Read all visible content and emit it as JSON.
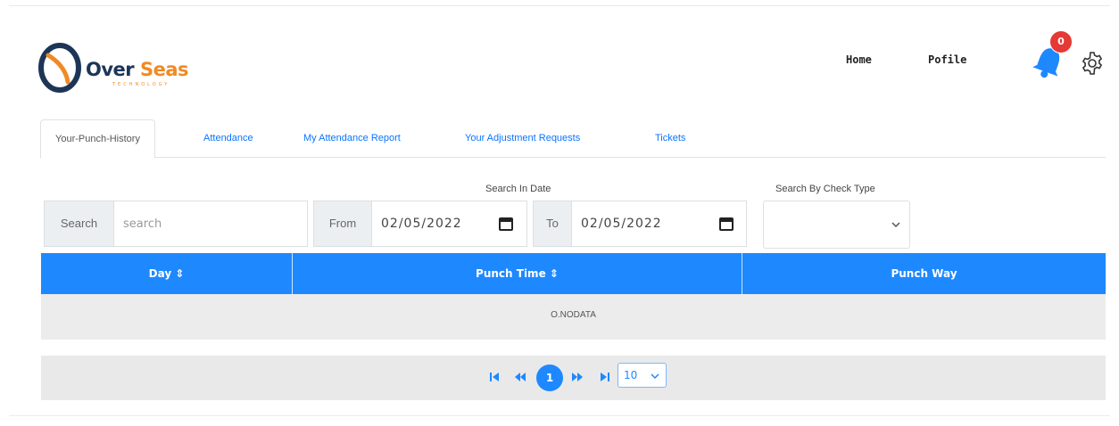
{
  "brand": {
    "name_part1": "Over",
    "name_part2": "Seas",
    "subtitle": "TECHNOLOGY"
  },
  "nav": {
    "home": "Home",
    "profile": "Pofile"
  },
  "notifications": {
    "count": "0"
  },
  "tabs": [
    {
      "label": "Your-Punch-History",
      "active": true
    },
    {
      "label": "Attendance"
    },
    {
      "label": "My Attendance Report"
    },
    {
      "label": "Your Adjustment Requests"
    },
    {
      "label": "Tickets"
    }
  ],
  "filters": {
    "search_label": "Search",
    "search_placeholder": "search",
    "date_title": "Search In Date",
    "from_label": "From",
    "from_value": "02/05/2022",
    "to_label": "To",
    "to_value": "02/05/2022",
    "check_type_title": "Search By Check Type",
    "check_type_value": ""
  },
  "table": {
    "columns": [
      "Day ⇕",
      "Punch Time ⇕",
      "Punch Way"
    ],
    "empty_message": "O.NODATA"
  },
  "paginator": {
    "current_page": "1",
    "page_size": "10"
  },
  "colors": {
    "primary": "#1e88ff",
    "brand_dark": "#1d3557",
    "brand_orange": "#f08a24",
    "badge": "#e53935"
  },
  "icons": [
    "logo-icon",
    "bell-icon",
    "gear-icon",
    "calendar-icon",
    "chevron-down-icon",
    "first-page-icon",
    "prev-page-icon",
    "next-page-icon",
    "last-page-icon"
  ]
}
